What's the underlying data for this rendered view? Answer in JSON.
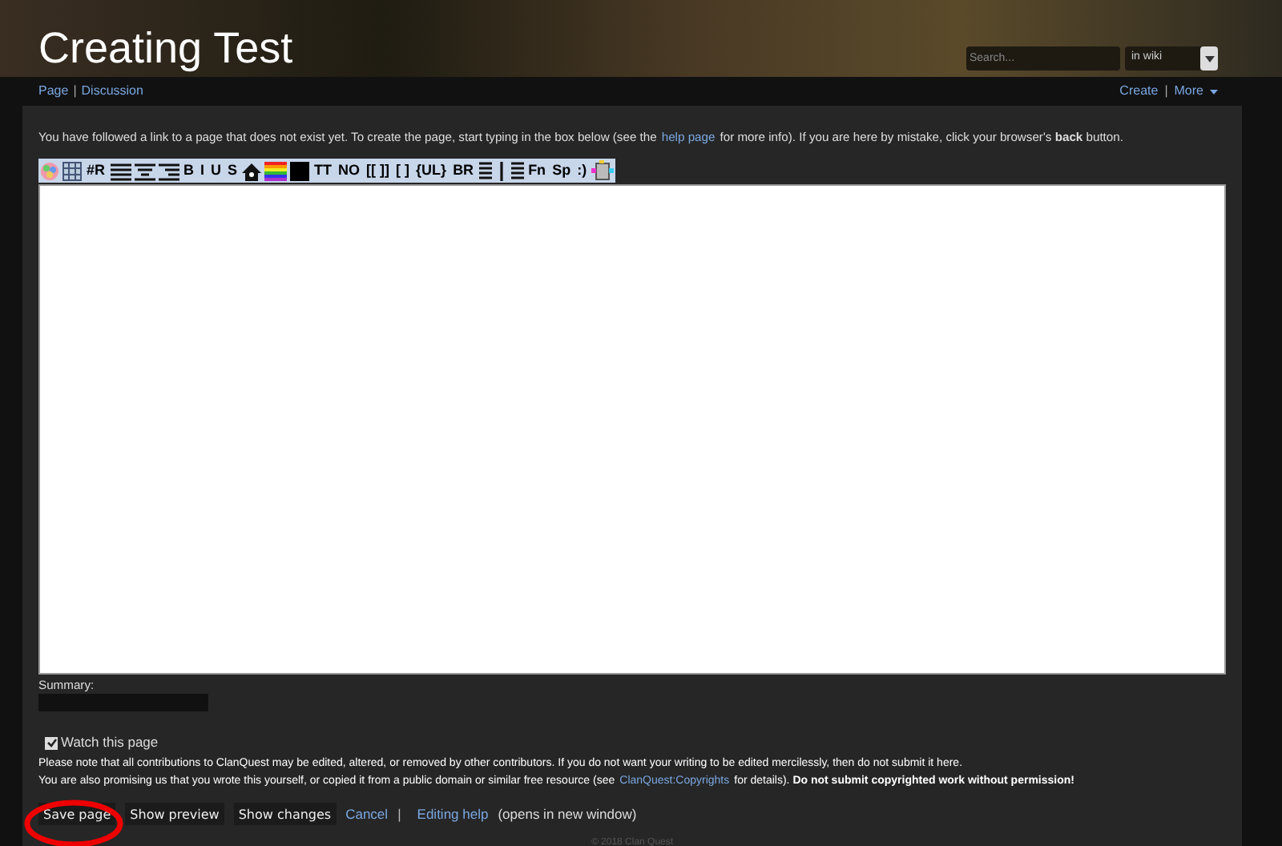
{
  "header": {
    "title": "Creating Test",
    "search": {
      "placeholder": "Search..."
    },
    "scope": {
      "value": "in wiki"
    }
  },
  "nav": {
    "separator": "|",
    "left": [
      {
        "label": "Page"
      },
      {
        "label": "Discussion"
      }
    ],
    "right": [
      {
        "label": "Create"
      },
      {
        "label": "More"
      }
    ]
  },
  "notice": [
    {
      "kind": "text",
      "text": "You have followed a link to a page that does not exist yet. To create the page, start typing in the box below (see the"
    },
    {
      "kind": "link",
      "text": "help page"
    },
    {
      "kind": "text",
      "text": "for more info). If you are here by mistake, click your browser's **back** button."
    }
  ],
  "toolbar": [
    {
      "kind": "palette"
    },
    {
      "kind": "grid"
    },
    {
      "kind": "text",
      "text": "#R"
    },
    {
      "kind": "alignleft"
    },
    {
      "kind": "aligncenter"
    },
    {
      "kind": "alignright"
    },
    {
      "kind": "text",
      "text": "B"
    },
    {
      "kind": "text",
      "text": "I"
    },
    {
      "kind": "text",
      "text": "U"
    },
    {
      "kind": "text",
      "text": "S"
    },
    {
      "kind": "house"
    },
    {
      "kind": "rainbow"
    },
    {
      "kind": "swatch"
    },
    {
      "kind": "text",
      "text": "TT"
    },
    {
      "kind": "text",
      "text": "NO"
    },
    {
      "kind": "text",
      "text": "[[ ]]"
    },
    {
      "kind": "text",
      "text": "[ ]"
    },
    {
      "kind": "text",
      "text": "{UL}"
    },
    {
      "kind": "text",
      "text": "BR"
    },
    {
      "kind": "lines"
    },
    {
      "kind": "rule"
    },
    {
      "kind": "lines"
    },
    {
      "kind": "text",
      "text": "Fn"
    },
    {
      "kind": "text",
      "text": "Sp"
    },
    {
      "kind": "text",
      "text": ":)"
    },
    {
      "kind": "gadget"
    }
  ],
  "summary": {
    "label": "Summary:"
  },
  "watch": {
    "label": "Watch this page",
    "checked": true
  },
  "copyright": [
    [
      {
        "kind": "text",
        "text": "Please note that all contributions to ClanQuest may be edited, altered, or removed by other contributors. If you do not want your writing to be edited mercilessly, then do not submit it here."
      }
    ],
    [
      {
        "kind": "text",
        "text": "You are also promising us that you wrote this yourself, or copied it from a public domain or similar free resource (see"
      },
      {
        "kind": "link",
        "text": "ClanQuest:Copyrights"
      },
      {
        "kind": "text",
        "text": "for details). **Do not submit copyrighted work without permission!**"
      }
    ]
  ],
  "actions": {
    "buttons": [
      "Save page",
      "Show preview",
      "Show changes"
    ],
    "cancel": "Cancel",
    "separator": "|",
    "help": "Editing help",
    "help_note": "(opens in new window)"
  },
  "footer": "© 2018 Clan Quest"
}
